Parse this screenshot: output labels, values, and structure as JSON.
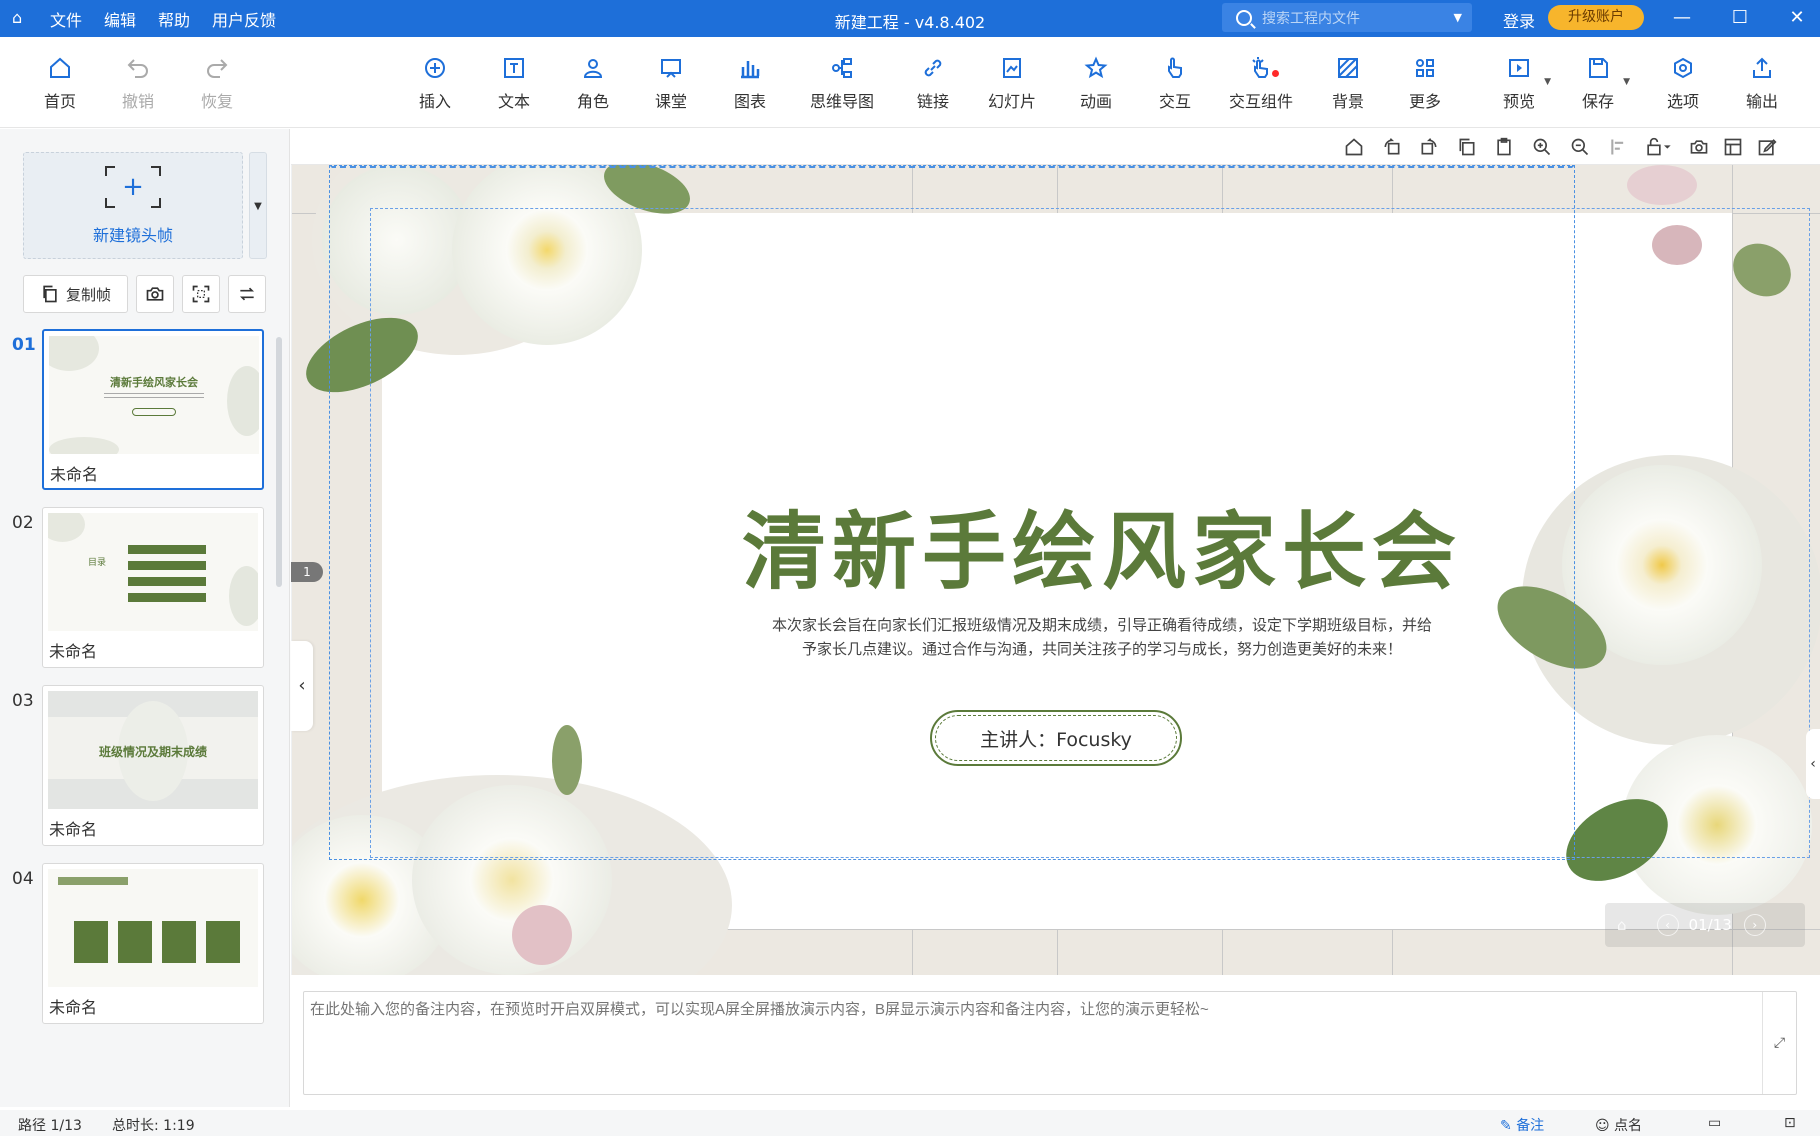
{
  "titlebar": {
    "app_icon": "app-logo-icon",
    "menu": [
      "文件",
      "编辑",
      "帮助",
      "用户反馈"
    ],
    "title": "新建工程 - v4.8.402",
    "search_placeholder": "搜索工程内文件",
    "login": "登录",
    "upgrade": "升级账户",
    "accent": "#1e6fd9"
  },
  "toolbar": {
    "home": "首页",
    "undo": "撤销",
    "redo": "恢复",
    "insert": "插入",
    "text": "文本",
    "role": "角色",
    "classroom": "课堂",
    "chart": "图表",
    "mindmap": "思维导图",
    "link": "链接",
    "slides": "幻灯片",
    "animation": "动画",
    "interaction": "交互",
    "interaction_widgets": "交互组件",
    "background": "背景",
    "more": "更多",
    "preview": "预览",
    "save": "保存",
    "options": "选项",
    "export": "输出"
  },
  "left_panel": {
    "new_frame": "新建镜头帧",
    "copy_frame": "复制帧",
    "slides": [
      {
        "num": "01",
        "label": "未命名",
        "thumb_title": "清新手绘风家长会"
      },
      {
        "num": "02",
        "label": "未命名",
        "thumb_title": "目录"
      },
      {
        "num": "03",
        "label": "未命名",
        "thumb_title": "班级情况及期末成绩"
      },
      {
        "num": "04",
        "label": "未命名",
        "thumb_title": ""
      }
    ]
  },
  "canvas": {
    "ruler_marker": "1",
    "slide_title": "清新手绘风家长会",
    "slide_desc_line1": "本次家长会旨在向家长们汇报班级情况及期末成绩，引导正确看待成绩，设定下学期班级目标，并给",
    "slide_desc_line2": "予家长几点建议。通过合作与沟通，共同关注孩子的学习与成长，努力创造更美好的未来！",
    "presenter": "主讲人：Focusky",
    "pager": "01/13",
    "title_color": "#5b7a3a"
  },
  "notes": {
    "placeholder": "在此处输入您的备注内容，在预览时开启双屏模式，可以实现A屏全屏播放演示内容，B屏显示演示内容和备注内容，让您的演示更轻松~"
  },
  "statusbar": {
    "path": "路径 1/13",
    "duration": "总时长: 1:19",
    "notes": "备注",
    "rollcall": "点名"
  }
}
